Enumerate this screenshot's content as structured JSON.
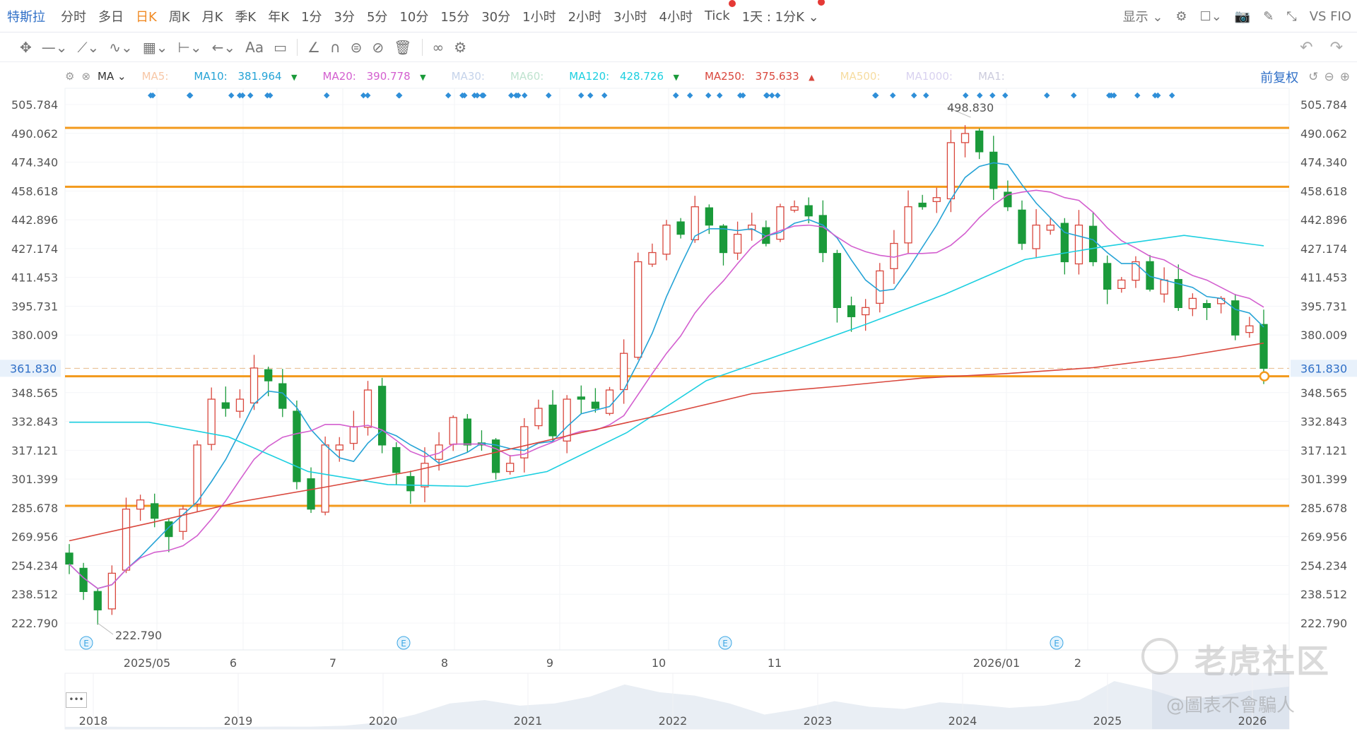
{
  "topbar": {
    "symbol": "特斯拉",
    "periods": [
      "分时",
      "多日",
      "日K",
      "周K",
      "月K",
      "季K",
      "年K",
      "1分",
      "3分",
      "5分",
      "10分",
      "15分",
      "30分",
      "1小时",
      "2小时",
      "3小时",
      "4小时",
      "Tick",
      "1天 : 1分K"
    ],
    "active": "日K",
    "display": "显示",
    "vs": "VS FIO"
  },
  "toolbar": {
    "icons": [
      "move-icon",
      "line-icon",
      "pen-icon",
      "wave-icon",
      "fib-icon",
      "measure-icon",
      "arrow-icon",
      "text-icon",
      "comment-icon",
      "ruler-icon",
      "magnet-icon",
      "lock-icon",
      "hide-icon",
      "trash-icon",
      "compare-icon",
      "settings-icon"
    ]
  },
  "mabar": {
    "indicator": "MA",
    "items": [
      {
        "label": "MA5:",
        "value": "",
        "color": "#f7c7a6"
      },
      {
        "label": "MA10:",
        "value": "381.964",
        "color": "#25a3d6",
        "arrow": "▼",
        "arrow_color": "#1a9a3a"
      },
      {
        "label": "MA20:",
        "value": "390.778",
        "color": "#d35fcf",
        "arrow": "▼",
        "arrow_color": "#1a9a3a"
      },
      {
        "label": "MA30:",
        "value": "",
        "color": "#c5d3ea"
      },
      {
        "label": "MA60:",
        "value": "",
        "color": "#bfe3cf"
      },
      {
        "label": "MA120:",
        "value": "428.726",
        "color": "#1ccfe0",
        "arrow": "▼",
        "arrow_color": "#1a9a3a"
      },
      {
        "label": "MA250:",
        "value": "375.633",
        "color": "#d9473d",
        "arrow": "▲",
        "arrow_color": "#d9473d"
      },
      {
        "label": "MA500:",
        "value": "",
        "color": "#f6dca0"
      },
      {
        "label": "MA1000:",
        "value": "",
        "color": "#d9d2f0"
      },
      {
        "label": "MA1:",
        "value": "",
        "color": "#ccd"
      }
    ],
    "adjust": "前复权"
  },
  "chart_data": {
    "type": "candlestick",
    "y_ticks": [
      "505.784",
      "490.062",
      "474.340",
      "458.618",
      "442.896",
      "427.174",
      "411.453",
      "395.731",
      "380.009",
      "361.830",
      "348.565",
      "332.843",
      "317.121",
      "301.399",
      "285.678",
      "269.956",
      "254.234",
      "238.512",
      "222.790"
    ],
    "current_price": "361.830",
    "high_label": "498.830",
    "low_label": "222.790",
    "x_labels": [
      "2025/05",
      "6",
      "7",
      "8",
      "9",
      "10",
      "11",
      "2026/01",
      "2"
    ],
    "closes": [
      255,
      240,
      230,
      250,
      285,
      290,
      280,
      270,
      285,
      320,
      345,
      340,
      345,
      362,
      355,
      340,
      300,
      285,
      320,
      320,
      330,
      350,
      320,
      305,
      295,
      310,
      320,
      335,
      320,
      320,
      305,
      310,
      330,
      340,
      325,
      345,
      345,
      340,
      350,
      370,
      420,
      425,
      440,
      435,
      450,
      440,
      425,
      435,
      440,
      430,
      450,
      450,
      445,
      425,
      395,
      390,
      395,
      415,
      430,
      450,
      450,
      455,
      485,
      490,
      480,
      460,
      450,
      430,
      440,
      440,
      420,
      440,
      420,
      405,
      410,
      420,
      405,
      410,
      395,
      400,
      395,
      400,
      380,
      385,
      361.83
    ],
    "ma120": [
      332.4,
      332.4,
      324.4,
      305.5,
      298.4,
      297.4,
      305.5,
      326.7,
      355.1,
      370.2,
      385.8,
      402.3,
      421.2,
      428.3,
      434.4,
      428.7
    ],
    "ma250": [
      267.7,
      278,
      289,
      297,
      305.5,
      316,
      326.7,
      337,
      348,
      352,
      356.5,
      359,
      362.2,
      368,
      375.6
    ],
    "levels": [
      493.06,
      460.9,
      357.5,
      286.8
    ],
    "level_color": "#f39a1c",
    "up_color": "#d9473d",
    "down_color": "#1a9a3a",
    "earnings_marker": "E"
  },
  "navigator": {
    "years": [
      "2018",
      "2019",
      "2020",
      "2021",
      "2022",
      "2023",
      "2024",
      "2025",
      "2026"
    ],
    "series": [
      20,
      21,
      20,
      19,
      18,
      20,
      22,
      21,
      30,
      60,
      130,
      230,
      260,
      210,
      230,
      290,
      400,
      330,
      300,
      230,
      130,
      180,
      250,
      200,
      180,
      240,
      220,
      190,
      210,
      260,
      430,
      360,
      260,
      300,
      350,
      380
    ]
  },
  "watermark": {
    "brand": "老虎社区",
    "author": "@圖表不會騙人"
  }
}
